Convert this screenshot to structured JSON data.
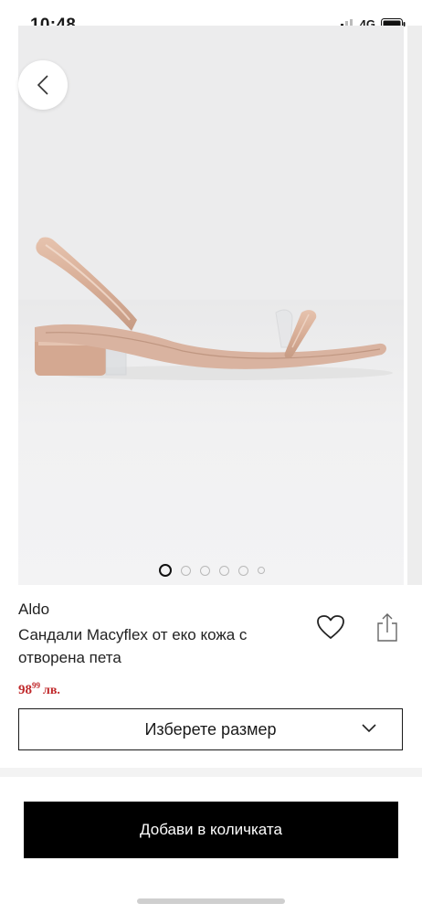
{
  "status_bar": {
    "time": "10:48",
    "network": "4G",
    "icons": [
      "signal-bars-icon",
      "battery-icon"
    ]
  },
  "gallery": {
    "image": "nude patent sandal with clear strap, side view",
    "back_icon": "chevron-left-icon",
    "dots_count": 6,
    "active_dot": 1
  },
  "product": {
    "brand": "Aldo",
    "title": "Сандали Macyflex от еко кожа с отворена пета",
    "price": {
      "integer": "98",
      "decimal": "99",
      "currency": "лв."
    },
    "favorite_icon": "heart-outline-icon",
    "share_icon": "share-icon"
  },
  "size_select": {
    "label": "Изберете размер",
    "icon": "chevron-down-icon"
  },
  "cta": {
    "add_to_cart": "Добави в количката"
  },
  "colors": {
    "price": "#c0292b",
    "cta_background": "#000000",
    "gallery_background": "#efeff0"
  }
}
